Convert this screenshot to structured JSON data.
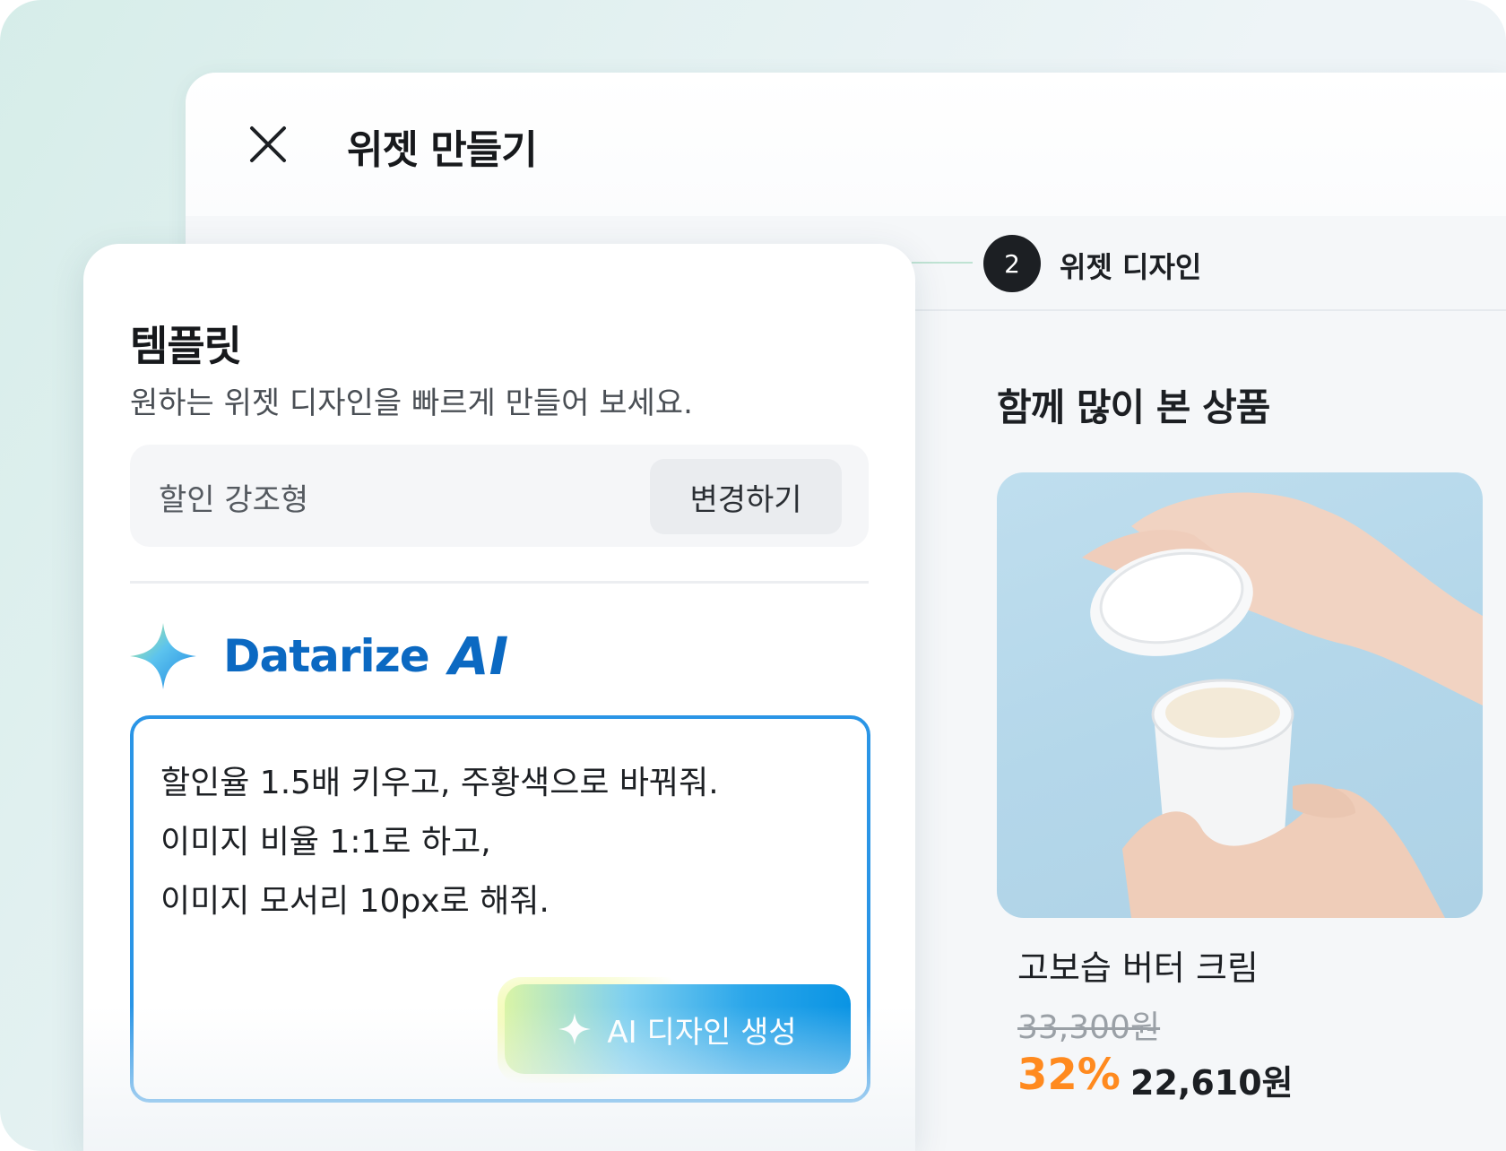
{
  "window": {
    "title": "위젯 만들기"
  },
  "stepper": {
    "step_number": "2",
    "step_label": "위젯 디자인"
  },
  "template_panel": {
    "title": "템플릿",
    "subtitle": "원하는 위젯 디자인을 빠르게 만들어 보세요.",
    "selected_template": "할인 강조형",
    "change_button": "변경하기"
  },
  "ai": {
    "brand": "Datarize",
    "brand_suffix": "AI",
    "prompt_lines": [
      "할인율 1.5배 키우고, 주황색으로 바꿔줘.",
      "이미지 비율 1:1로 하고,",
      "이미지 모서리 10px로 해줘."
    ],
    "generate_button": "AI 디자인 생성"
  },
  "preview": {
    "heading": "함께 많이 본 상품",
    "product": {
      "name": "고보습 버터 크림",
      "original_price": "33,300원",
      "discount": "32%",
      "price": "22,610원"
    }
  },
  "colors": {
    "accent_blue": "#0b69c2",
    "prompt_border": "#2a95e6",
    "discount_orange": "#ff8a1f"
  }
}
